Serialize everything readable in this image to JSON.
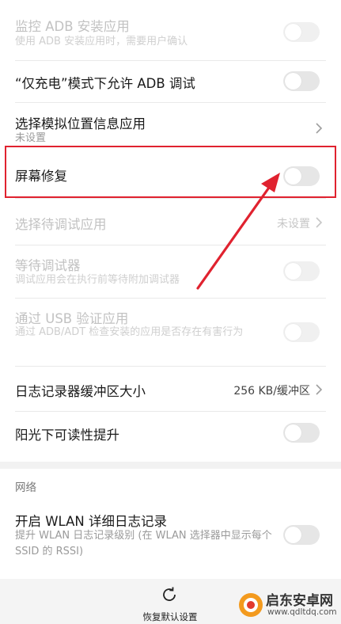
{
  "settings": [
    {
      "title": "监控 ADB 安装应用",
      "subtitle": "使用 ADB 安装应用时，需要用户确认"
    },
    {
      "title": "“仅充电”模式下允许 ADB 调试"
    },
    {
      "title": "选择模拟位置信息应用",
      "subtitle": "未设置"
    },
    {
      "title": "屏幕修复"
    },
    {
      "title": "选择待调试应用",
      "value": "未设置"
    },
    {
      "title": "等待调试器",
      "subtitle": "调试应用会在执行前等待附加调试器"
    },
    {
      "title": "通过 USB 验证应用",
      "subtitle": "通过 ADB/ADT 检查安装的应用是否存在有害行为"
    },
    {
      "title": "日志记录器缓冲区大小",
      "value": "256 KB/缓冲区"
    },
    {
      "title": "阳光下可读性提升"
    }
  ],
  "network": {
    "header": "网络",
    "items": [
      {
        "title": "开启 WLAN 详细日志记录",
        "subtitle": "提升 WLAN 日志记录级别 (在 WLAN 选择器中显示每个 SSID 的 RSSI)"
      }
    ]
  },
  "bottom_bar": {
    "restore_label": "恢复默认设置"
  },
  "watermark": {
    "text": "启东安卓网",
    "url": "www.qdltdq.com"
  },
  "colors": {
    "highlight": "#e0222f",
    "arrow": "#e0222f"
  }
}
